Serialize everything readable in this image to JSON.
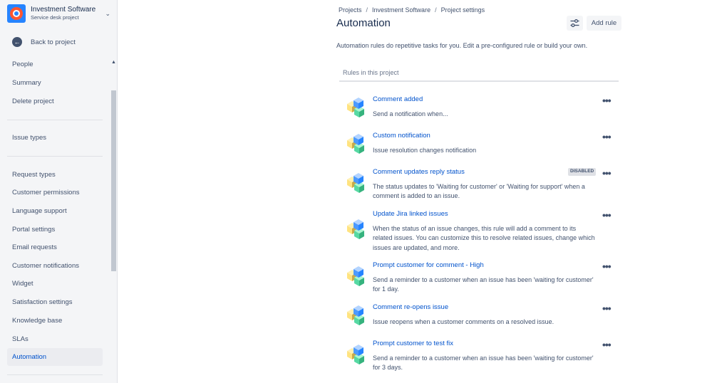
{
  "sidebar": {
    "project_name": "Investment Software",
    "project_type": "Service desk project",
    "back_label": "Back to project",
    "items": [
      {
        "label": "People"
      },
      {
        "label": "Summary"
      },
      {
        "label": "Delete project"
      },
      {
        "label": "Issue types"
      },
      {
        "label": "Request types"
      },
      {
        "label": "Customer permissions"
      },
      {
        "label": "Language support"
      },
      {
        "label": "Portal settings"
      },
      {
        "label": "Email requests"
      },
      {
        "label": "Customer notifications"
      },
      {
        "label": "Widget"
      },
      {
        "label": "Satisfaction settings"
      },
      {
        "label": "Knowledge base"
      },
      {
        "label": "SLAs"
      },
      {
        "label": "Automation"
      }
    ],
    "active_item": "Automation"
  },
  "breadcrumb": [
    "Projects",
    "Investment Software",
    "Project settings"
  ],
  "page": {
    "title": "Automation",
    "add_rule_label": "Add rule",
    "description": "Automation rules do repetitive tasks for you. Edit a pre-configured rule or build your own.",
    "rules_header": "Rules in this project"
  },
  "rules": [
    {
      "title": "Comment added",
      "description": "Send a notification when...",
      "badge": ""
    },
    {
      "title": "Custom notification",
      "description": "Issue resolution changes notification",
      "badge": ""
    },
    {
      "title": "Comment updates reply status",
      "description": "The status updates to 'Waiting for customer' or 'Waiting for support' when a\ncomment is added to an issue.",
      "badge": "DISABLED"
    },
    {
      "title": "Update Jira linked issues",
      "description": "When the status of an issue changes, this rule will add a comment to its\nrelated issues. You can customize this to resolve related issues, change which\nissues are updated, and more.",
      "badge": ""
    },
    {
      "title": "Prompt customer for comment - High",
      "description": "Send a reminder to a customer when an issue has been 'waiting for customer'\nfor 1 day.",
      "badge": ""
    },
    {
      "title": "Comment re-opens issue",
      "description": "Issue reopens when a customer comments on a resolved issue.",
      "badge": ""
    },
    {
      "title": "Prompt customer to test fix",
      "description": "Send a reminder to a customer when an issue has been 'waiting for customer'\nfor 3 days.",
      "badge": ""
    }
  ],
  "icons": {
    "project_avatar": "lifebuoy-icon",
    "back": "arrow-left-icon",
    "settings": "sliders-icon",
    "rule": "cubes-icon",
    "more": "more-horizontal-icon"
  },
  "colors": {
    "accent": "#0052cc",
    "sidebar_bg": "#f4f5f7",
    "text": "#172b4d",
    "muted": "#42526e",
    "cube_blue": "#4c9aff",
    "cube_yellow": "#ffe380",
    "cube_green": "#57d9a3"
  }
}
